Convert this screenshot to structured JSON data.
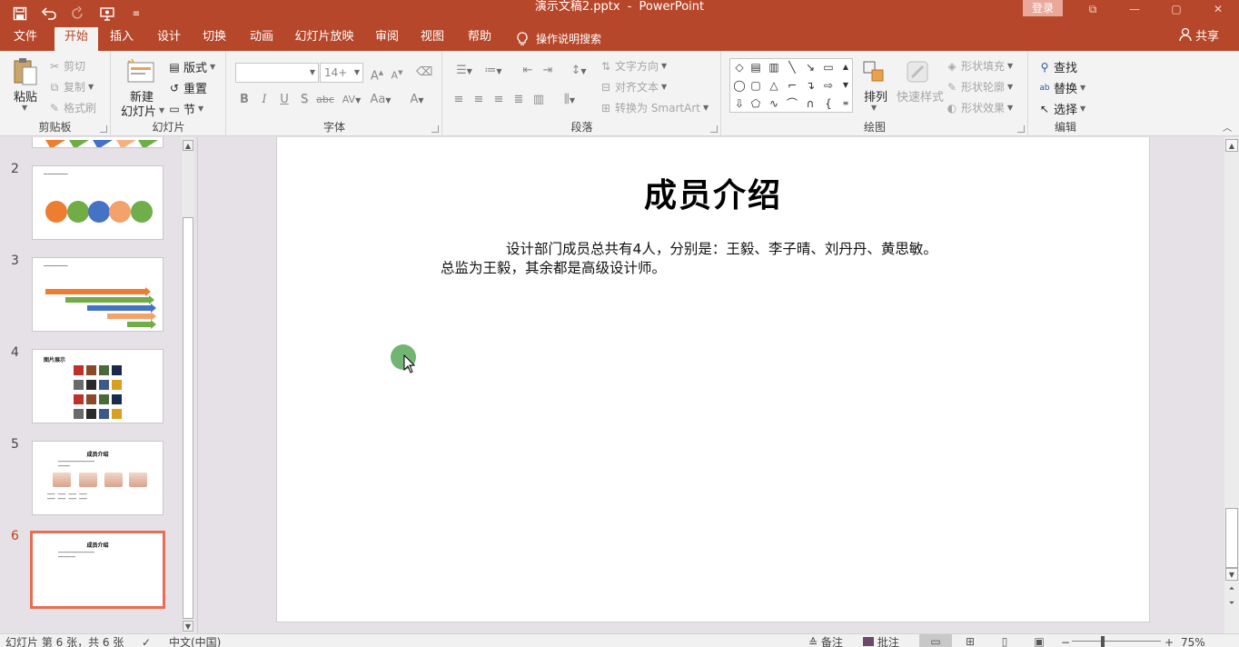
{
  "title_bar": {
    "document": "演示文稿2.pptx",
    "separator": "-",
    "app": "PowerPoint",
    "login_label": "登录",
    "restore_ribbon_icon": "⧉",
    "minimize_icon": "—",
    "maximize_icon": "▢",
    "close_icon": "✕"
  },
  "quick_access": {
    "save_icon": "save-icon",
    "undo_icon": "undo-icon",
    "redo_icon": "redo-icon",
    "present_icon": "present-icon",
    "customize_icon": "customize-icon"
  },
  "tabs": [
    {
      "label": "文件"
    },
    {
      "label": "开始"
    },
    {
      "label": "插入"
    },
    {
      "label": "设计"
    },
    {
      "label": "切换"
    },
    {
      "label": "动画"
    },
    {
      "label": "幻灯片放映"
    },
    {
      "label": "审阅"
    },
    {
      "label": "视图"
    },
    {
      "label": "帮助"
    }
  ],
  "tell_me": "操作说明搜索",
  "share": "共享",
  "ribbon": {
    "clipboard": {
      "label": "剪贴板",
      "paste": "粘贴",
      "cut": "剪切",
      "copy": "复制",
      "format_painter": "格式刷"
    },
    "slides": {
      "label": "幻灯片",
      "new_slide_line1": "新建",
      "new_slide_line2": "幻灯片",
      "layout": "版式",
      "reset": "重置",
      "section": "节"
    },
    "font": {
      "label": "字体",
      "font_name": "",
      "font_size": "14+",
      "bold": "B",
      "italic": "I",
      "underline": "U",
      "shadow": "S",
      "strike": "abc",
      "spacing": "AV",
      "case": "Aa",
      "color": "A",
      "grow": "A",
      "shrink": "A"
    },
    "paragraph": {
      "label": "段落",
      "text_direction": "文字方向",
      "align_text": "对齐文本",
      "smartart": "转换为 SmartArt"
    },
    "drawing": {
      "label": "绘图",
      "arrange": "排列",
      "quick_styles": "快速样式",
      "shape_fill": "形状填充",
      "shape_outline": "形状轮廓",
      "shape_effects": "形状效果"
    },
    "editing": {
      "label": "编辑",
      "find": "查找",
      "replace": "替换",
      "select": "选择"
    }
  },
  "thumbnails": [
    {
      "num": "2"
    },
    {
      "num": "3"
    },
    {
      "num": "4",
      "title": "图片展示"
    },
    {
      "num": "5",
      "title": "成员介绍"
    },
    {
      "num": "6",
      "title": "成员介绍"
    }
  ],
  "slide": {
    "title": "成员介绍",
    "body_line1": "设计部门成员总共有4人，分别是：王毅、李子晴、刘丹丹、黄思敏。",
    "body_line2": "总监为王毅，其余都是高级设计师。"
  },
  "status_bar": {
    "slide_info": "幻灯片 第 6 张，共 6 张",
    "language": "中文(中国)",
    "notes": "备注",
    "comments": "批注",
    "zoom": "75%"
  },
  "colors": {
    "accent": "#b7472a",
    "selected_thumb": "#e76d53",
    "cursor": "#6ab06a"
  }
}
